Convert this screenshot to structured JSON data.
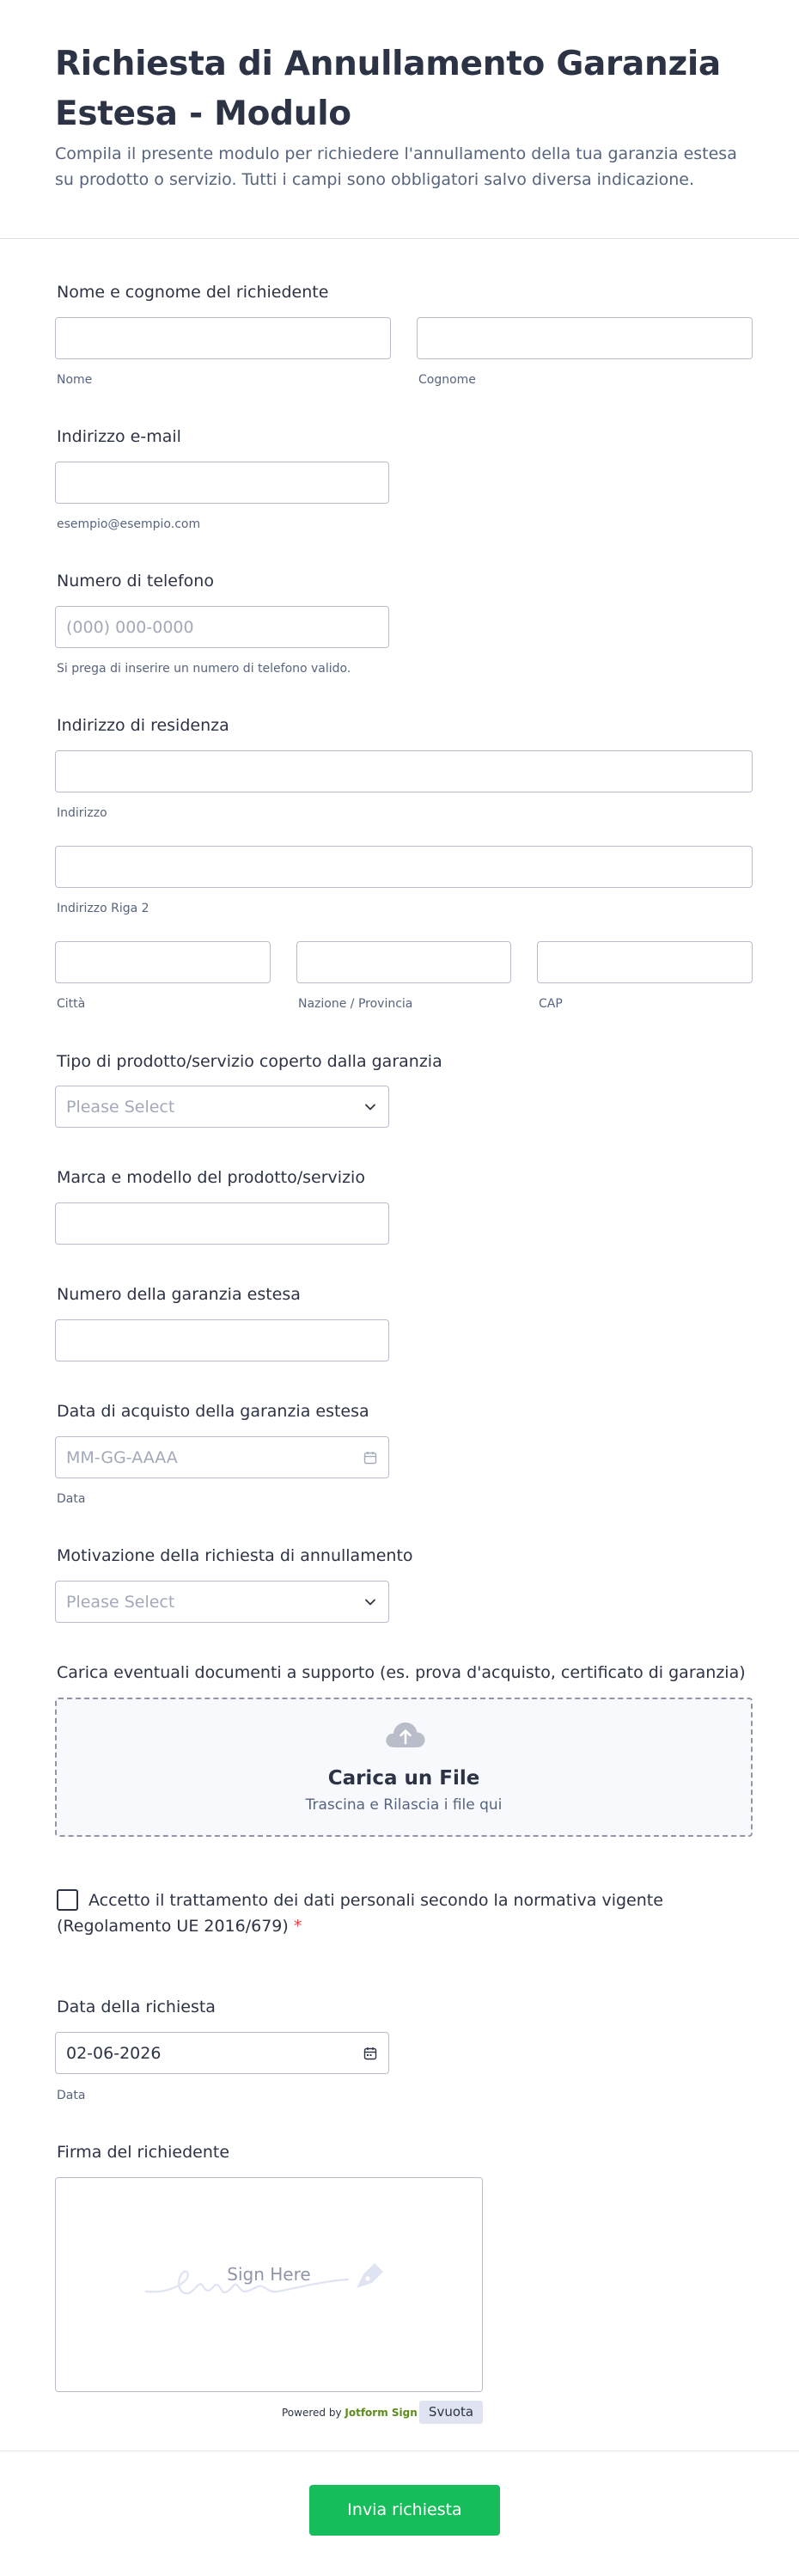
{
  "header": {
    "title": "Richiesta di Annullamento Garanzia Estesa - Modulo",
    "description": "Compila il presente modulo per richiedere l'annullamento della tua garanzia estesa su prodotto o servizio. Tutti i campi sono obbligatori salvo diversa indicazione."
  },
  "name": {
    "label": "Nome e cognome del richiedente",
    "first_sublabel": "Nome",
    "last_sublabel": "Cognome"
  },
  "email": {
    "label": "Indirizzo e-mail",
    "sublabel": "esempio@esempio.com"
  },
  "phone": {
    "label": "Numero di telefono",
    "placeholder": "(000) 000-0000",
    "sublabel": "Si prega di inserire un numero di telefono valido."
  },
  "address": {
    "label": "Indirizzo di residenza",
    "line1_sublabel": "Indirizzo",
    "line2_sublabel": "Indirizzo Riga 2",
    "city_sublabel": "Città",
    "state_sublabel": "Nazione / Provincia",
    "zip_sublabel": "CAP"
  },
  "product_type": {
    "label": "Tipo di prodotto/servizio coperto dalla garanzia",
    "selected": "Please Select"
  },
  "brand_model": {
    "label": "Marca e modello del prodotto/servizio"
  },
  "warranty_number": {
    "label": "Numero della garanzia estesa"
  },
  "purchase_date": {
    "label": "Data di acquisto della garanzia estesa",
    "placeholder": "MM-GG-AAAA",
    "sublabel": "Data"
  },
  "reason": {
    "label": "Motivazione della richiesta di annullamento",
    "selected": "Please Select"
  },
  "upload": {
    "label": "Carica eventuali documenti a supporto (es. prova d'acquisto, certificato di garanzia)",
    "title": "Carica un File",
    "subtitle": "Trascina e Rilascia i file qui"
  },
  "consent": {
    "text": "Accetto il trattamento dei dati personali secondo la normativa vigente (Regolamento UE 2016/679)",
    "required_mark": "*"
  },
  "request_date": {
    "label": "Data della richiesta",
    "value": "02-06-2026",
    "sublabel": "Data"
  },
  "signature": {
    "label": "Firma del richiedente",
    "hint": "Sign Here",
    "powered_prefix": "Powered by",
    "powered_brand": "Jotform Sign",
    "clear_label": "Svuota"
  },
  "submit": {
    "label": "Invia richiesta"
  },
  "colors": {
    "submit": "#18bd5b",
    "required": "#f23a3c",
    "text": "#2c3345"
  }
}
